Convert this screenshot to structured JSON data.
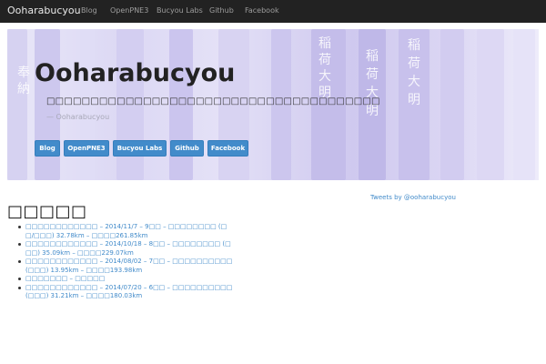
{
  "navbar": {
    "brand": "Ooharabucyou",
    "links": [
      "Blog",
      "OpenPNE3",
      "Bucyou Labs",
      "Github",
      "Facebook"
    ]
  },
  "hero": {
    "title": "Ooharabucyou",
    "description": "□□□□□□□□□□□□□□□□□□□□□□□□□□□□□□□□□□□□□□",
    "cite": "— Ooharabucyou",
    "buttons": [
      "Blog",
      "OpenPNE3",
      "Bucyou Labs",
      "Github",
      "Facebook"
    ],
    "banner_text": [
      "稲",
      "荷",
      "大",
      "明",
      "稲",
      "荷",
      "大",
      "明",
      "奉",
      "納",
      "稲",
      "荷",
      "大",
      "明"
    ]
  },
  "tweets_link": "Tweets by @ooharabucyou",
  "section_title": "□□□□□",
  "posts": [
    {
      "line1": "□□□□□□□□□□□□ – 2014/11/7 – 9□□ – □□□□□□□□ (□",
      "line2": "□/□□□) 32.78km – □□□□261.85km"
    },
    {
      "line1": "□□□□□□□□□□□□ – 2014/10/18 – 8□□ – □□□□□□□□ (□",
      "line2": "□□) 35.09km – □□□□229.07km"
    },
    {
      "line1": "□□□□□□□□□□□□ – 2014/08/02 – 7□□ – □□□□□□□□□□",
      "line2": "(□□□) 13.95km – □□□□193.98km"
    },
    {
      "line1": "□□□□□□□ – □□□□□"
    },
    {
      "line1": "□□□□□□□□□□□□ – 2014/07/20 – 6□□ – □□□□□□□□□□",
      "line2": "(□□□) 31.21km – □□□□180.03km"
    }
  ],
  "colors": {
    "navbar": "#222222",
    "brand_text": "#e8e8e8",
    "nav_link": "#9d9d9d",
    "primary_button": "#428bca",
    "link": "#428bca",
    "hero_tint": "#d9d4f3"
  }
}
